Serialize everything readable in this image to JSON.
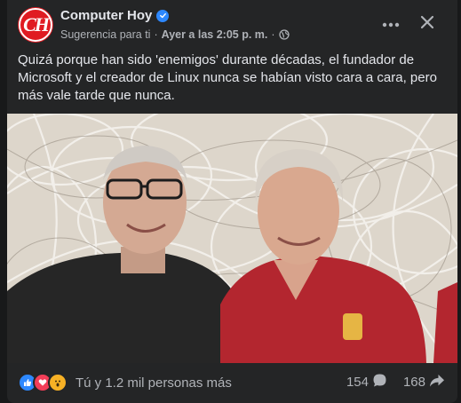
{
  "post": {
    "page_name": "Computer Hoy",
    "avatar_text": "CH",
    "suggestion": "Sugerencia para ti",
    "separator": "·",
    "timestamp": "Ayer a las 2:05 p. m.",
    "separator2": "·",
    "caption": "Quizá porque han sido 'enemigos' durante décadas, el fundador de Microsoft y el creador de Linux nunca se habían visto cara a cara, pero más vale tarde que nunca.",
    "reactions_text": "Tú y 1.2 mil personas más",
    "comments_count": "154",
    "shares_count": "168"
  },
  "icons": {
    "verified": "verified-badge-icon",
    "globe": "globe-icon",
    "more": "more-options-icon",
    "close": "close-icon",
    "like": "like-reaction-icon",
    "love": "love-reaction-icon",
    "wow": "wow-reaction-icon",
    "comment": "comment-icon",
    "share": "share-icon"
  },
  "colors": {
    "background": "#18191a",
    "card": "#242526",
    "primary_text": "#e4e6eb",
    "secondary_text": "#b0b3b8",
    "brand_red": "#e01b22",
    "accent_blue": "#2d88ff"
  }
}
